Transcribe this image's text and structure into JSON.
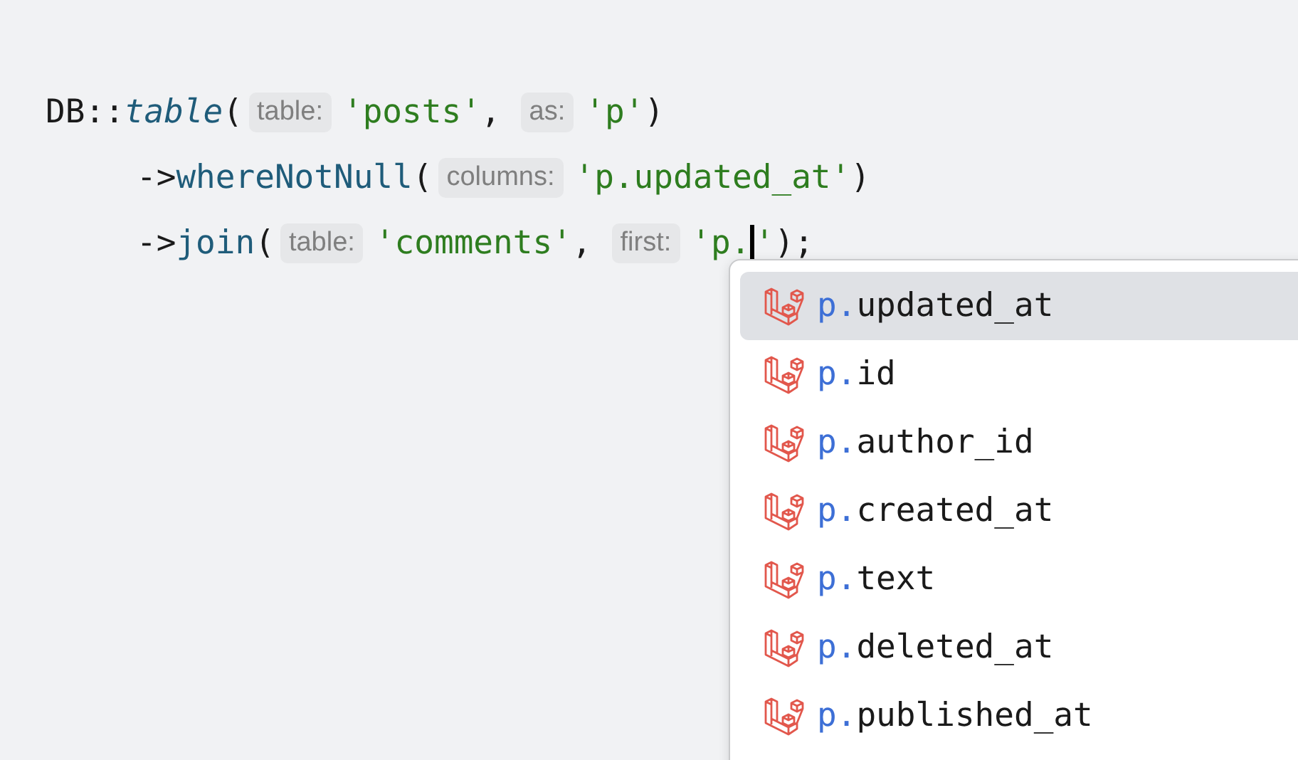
{
  "code_lines": [
    {
      "indent": false,
      "tokens": [
        {
          "kind": "plain",
          "text": "DB::"
        },
        {
          "kind": "static_call",
          "text": "table"
        },
        {
          "kind": "plain",
          "text": "("
        },
        {
          "kind": "hint",
          "text": "table:"
        },
        {
          "kind": "string",
          "text": "'posts'"
        },
        {
          "kind": "plain",
          "text": ","
        },
        {
          "kind": "hint",
          "text": "as:"
        },
        {
          "kind": "string",
          "text": "'p'"
        },
        {
          "kind": "plain",
          "text": ")"
        }
      ]
    },
    {
      "indent": true,
      "tokens": [
        {
          "kind": "plain",
          "text": "->"
        },
        {
          "kind": "method",
          "text": "whereNotNull"
        },
        {
          "kind": "plain",
          "text": "("
        },
        {
          "kind": "hint",
          "text": "columns:"
        },
        {
          "kind": "string",
          "text": "'p.updated_at'"
        },
        {
          "kind": "plain",
          "text": ")"
        }
      ]
    },
    {
      "indent": true,
      "tokens": [
        {
          "kind": "plain",
          "text": "->"
        },
        {
          "kind": "method",
          "text": "join"
        },
        {
          "kind": "plain",
          "text": "("
        },
        {
          "kind": "hint",
          "text": "table:"
        },
        {
          "kind": "string",
          "text": "'comments'"
        },
        {
          "kind": "plain",
          "text": ","
        },
        {
          "kind": "hint",
          "text": "first:"
        },
        {
          "kind": "string",
          "text": "'p."
        },
        {
          "kind": "caret"
        },
        {
          "kind": "string",
          "text": "'"
        },
        {
          "kind": "plain",
          "text": ");"
        }
      ]
    }
  ],
  "completion": {
    "items": [
      {
        "prefix": "p.",
        "name": "updated_at",
        "selected": true
      },
      {
        "prefix": "p.",
        "name": "id",
        "selected": false
      },
      {
        "prefix": "p.",
        "name": "author_id",
        "selected": false
      },
      {
        "prefix": "p.",
        "name": "created_at",
        "selected": false
      },
      {
        "prefix": "p.",
        "name": "text",
        "selected": false
      },
      {
        "prefix": "p.",
        "name": "deleted_at",
        "selected": false
      },
      {
        "prefix": "p.",
        "name": "published_at",
        "selected": false
      }
    ]
  }
}
